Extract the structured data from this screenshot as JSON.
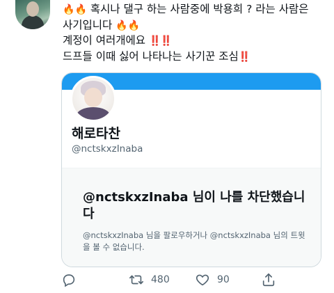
{
  "tweet": {
    "fire": "🔥",
    "bang": "‼️",
    "line1_text": "혹시나 댈구 하는 사람중에 박용희 ? 라는 사람은",
    "line2_text": "사기입니다",
    "line3_text": "계정이 여러개에요",
    "line4_text": "드프들 이때 싫어 나타나는 사기꾼 조심"
  },
  "card": {
    "name": "해로타찬",
    "handle": "@nctskxzInaba",
    "blocked_title": "@nctskxzInaba 님이 나를 차단했습니다",
    "blocked_sub": "@nctskxzInaba 님을 팔로우하거나 @nctskxzInaba 님의 트윗을 볼 수 없습니다."
  },
  "actions": {
    "retweet_count": "480",
    "like_count": "90"
  },
  "colors": {
    "accent": "#1d9bf0",
    "text": "#0f1419",
    "secondary": "#536471"
  }
}
